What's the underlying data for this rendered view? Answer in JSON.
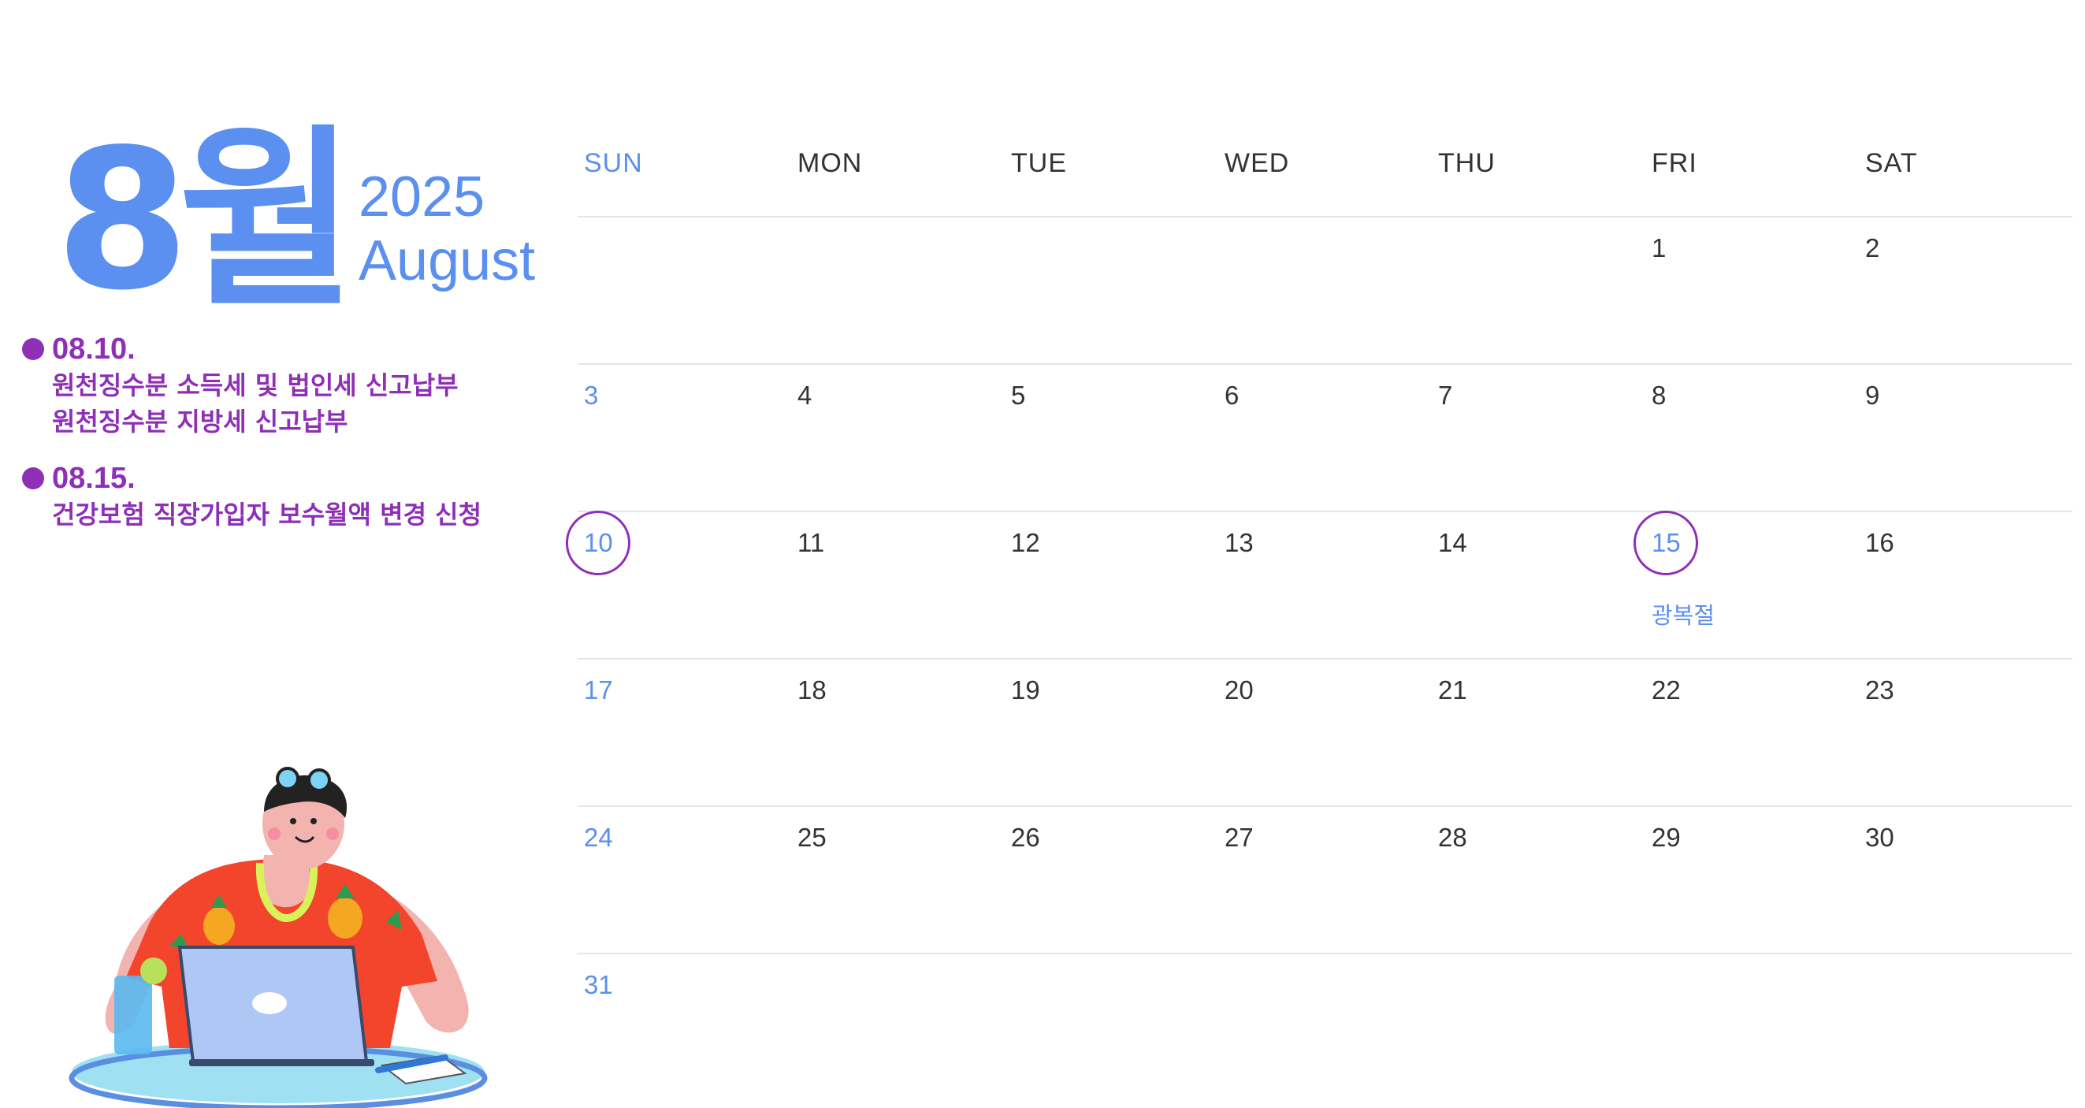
{
  "header": {
    "month_korean": "8월",
    "year": "2025",
    "month_english": "August"
  },
  "events": [
    {
      "date": "08.10.",
      "lines": [
        "원천징수분 소득세 및 법인세 신고납부",
        "원천징수분 지방세 신고납부"
      ]
    },
    {
      "date": "08.15.",
      "lines": [
        "건강보험 직장가입자 보수월액 변경 신청"
      ]
    }
  ],
  "calendar": {
    "weekdays": [
      "SUN",
      "MON",
      "TUE",
      "WED",
      "THU",
      "FRI",
      "SAT"
    ],
    "weeks": [
      [
        "",
        "",
        "",
        "",
        "",
        "1",
        "2"
      ],
      [
        "3",
        "4",
        "5",
        "6",
        "7",
        "8",
        "9"
      ],
      [
        "10",
        "11",
        "12",
        "13",
        "14",
        "15",
        "16"
      ],
      [
        "17",
        "18",
        "19",
        "20",
        "21",
        "22",
        "23"
      ],
      [
        "24",
        "25",
        "26",
        "27",
        "28",
        "29",
        "30"
      ],
      [
        "31",
        "",
        "",
        "",
        "",
        "",
        ""
      ]
    ],
    "holiday_label": "광복절"
  },
  "colors": {
    "accent_blue": "#5b8ff0",
    "accent_purple": "#8e2fb5",
    "grid_line": "#e6e6e6"
  }
}
